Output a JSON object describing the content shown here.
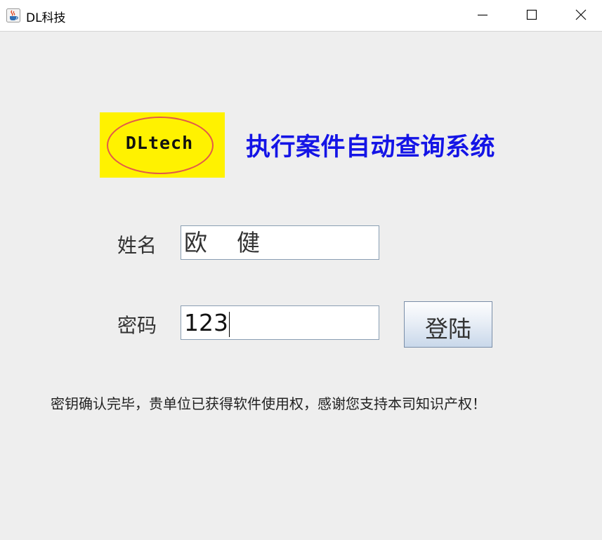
{
  "window": {
    "title": "DL科技",
    "icon": "java-coffee-icon",
    "controls": {
      "minimize_icon": "minimize-icon",
      "maximize_icon": "maximize-icon",
      "close_icon": "close-icon"
    }
  },
  "header": {
    "logo_text": "DLtech",
    "logo_bg_color": "#fff200",
    "app_title": "执行案件自动查询系统",
    "app_title_color": "#1414e6"
  },
  "form": {
    "name_label": "姓名",
    "name_value": "欧    健",
    "password_label": "密码",
    "password_value": "123",
    "login_button": "登陆"
  },
  "notice": "密钥确认完毕，贵单位已获得软件使用权，感谢您支持本司知识产权！"
}
